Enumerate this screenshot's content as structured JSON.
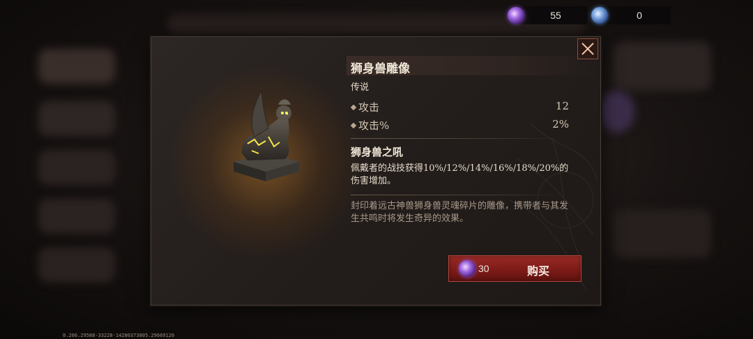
{
  "currencies": [
    {
      "icon": "purple-gem-icon",
      "amount": "55"
    },
    {
      "icon": "blue-gem-icon",
      "amount": "0"
    }
  ],
  "item": {
    "name": "狮身兽雕像",
    "rarity": "传说",
    "stats": [
      {
        "name": "攻击",
        "value": "12"
      },
      {
        "name": "攻击%",
        "value": "2%"
      }
    ],
    "skill": {
      "name": "狮身兽之吼",
      "description": "佩戴者的战技获得10%/12%/14%/16%/18%/20%的伤害增加。"
    },
    "flavor_text": "封印着远古神兽狮身兽灵魂碎片的雕像，携带者与其发生共鸣时将发生奇异的效果。"
  },
  "buy": {
    "price": "30",
    "label": "购买",
    "currency_icon": "purple-gem-icon"
  },
  "version": "0.206.29588-33228-14280373805.29669120",
  "colors": {
    "accent_red": "#8a2220",
    "gold_glow": "#b97828"
  }
}
